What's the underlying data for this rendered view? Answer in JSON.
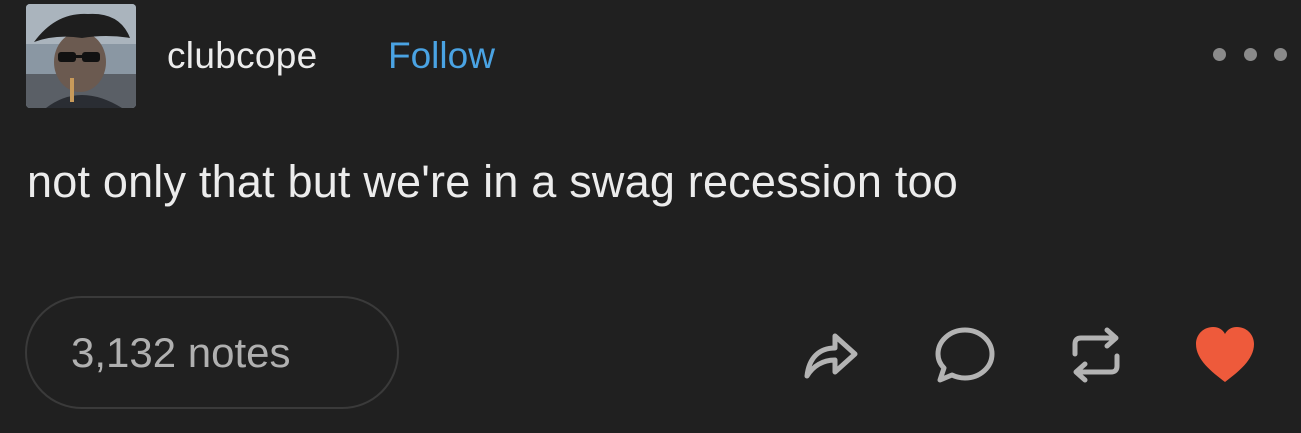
{
  "post": {
    "username": "clubcope",
    "follow_label": "Follow",
    "text": "not only that but we're in a swag recession too",
    "notes_label": "3,132 notes"
  },
  "icons": {
    "avatar": "user-avatar",
    "more": "more-options-icon",
    "share": "share-icon",
    "reply": "reply-icon",
    "reblog": "reblog-icon",
    "like": "heart-icon"
  },
  "colors": {
    "background": "#202020",
    "follow": "#4aa3e3",
    "like": "#ee5a3b",
    "icon": "#b3b3b3"
  }
}
